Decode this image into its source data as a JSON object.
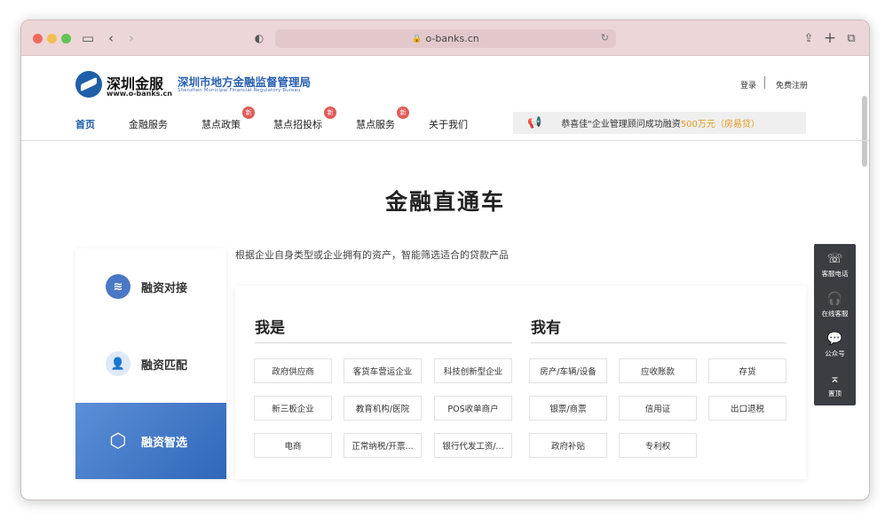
{
  "browser": {
    "url": "o-banks.cn"
  },
  "site": {
    "brand_cn": "深圳金服",
    "brand_url": "www.o-banks.cn",
    "bureau_cn": "深圳市地方金融监督管理局",
    "bureau_en": "Shenzhen Municipal Financial Regulatory Bureau",
    "login": "登录",
    "register": "免费注册"
  },
  "nav": {
    "items": [
      {
        "label": "首页"
      },
      {
        "label": "金融服务"
      },
      {
        "label": "慧点政策",
        "badge": "新"
      },
      {
        "label": "慧点招投标",
        "badge": "新"
      },
      {
        "label": "慧点服务",
        "badge": "新"
      },
      {
        "label": "关于我们"
      }
    ]
  },
  "notice": {
    "prefix": "恭喜佳\"企业管理顾问成功融资",
    "amount": "500万元",
    "suffix": "（房易贷）"
  },
  "hero": {
    "title": "金融直通车",
    "subtitle": "根据企业自身类型或企业拥有的资产，智能筛选适合的贷款产品"
  },
  "tabs": [
    {
      "label": "融资对接",
      "icon": "handshake-icon"
    },
    {
      "label": "融资匹配",
      "icon": "person-icon"
    },
    {
      "label": "融资智选",
      "icon": "hexagon-icon"
    }
  ],
  "panel": {
    "left_title": "我是",
    "right_title": "我有",
    "left_options": [
      "政府供应商",
      "客货车营运企业",
      "科技创新型企业",
      "新三板企业",
      "教育机构/医院",
      "POS收单商户",
      "电商",
      "正常纳税/开票...",
      "银行代发工资/..."
    ],
    "right_options": [
      "房产/车辆/设备",
      "应收账款",
      "存货",
      "银票/商票",
      "信用证",
      "出口退税",
      "政府补贴",
      "专利权"
    ]
  },
  "side_tools": [
    {
      "label": "客服电话",
      "icon": "phone-icon"
    },
    {
      "label": "在线客服",
      "icon": "headset-icon"
    },
    {
      "label": "公众号",
      "icon": "wechat-icon"
    },
    {
      "label": "置顶",
      "icon": "top-icon"
    }
  ]
}
